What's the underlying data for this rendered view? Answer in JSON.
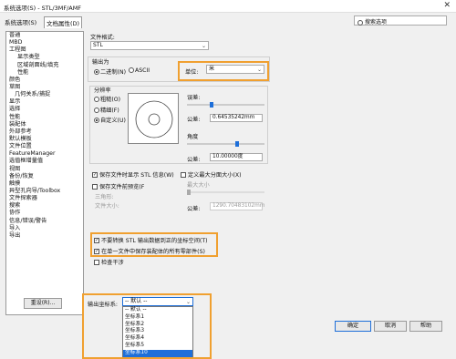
{
  "title": "系统选项(S) - STL/3MF/AMF",
  "tabs": [
    "系统选项(S)",
    "文档属性(D)"
  ],
  "search_placeholder": "搜索选项",
  "tree": [
    {
      "label": "普通",
      "level": 0
    },
    {
      "label": "MBD",
      "level": 0
    },
    {
      "label": "工程图",
      "level": 0
    },
    {
      "label": "显示类型",
      "level": 2
    },
    {
      "label": "区域剖面线/填充",
      "level": 2
    },
    {
      "label": "性能",
      "level": 2
    },
    {
      "label": "颜色",
      "level": 0
    },
    {
      "label": "草图",
      "level": 0
    },
    {
      "label": "几何关系/捕捉",
      "level": 1
    },
    {
      "label": "显示",
      "level": 0
    },
    {
      "label": "选择",
      "level": 0
    },
    {
      "label": "性能",
      "level": 0
    },
    {
      "label": "装配体",
      "level": 0
    },
    {
      "label": "外部参考",
      "level": 0
    },
    {
      "label": "默认模板",
      "level": 0
    },
    {
      "label": "文件位置",
      "level": 0
    },
    {
      "label": "FeatureManager",
      "level": 0
    },
    {
      "label": "选值框增量值",
      "level": 0
    },
    {
      "label": "视图",
      "level": 0
    },
    {
      "label": "备份/恢复",
      "level": 0
    },
    {
      "label": "触摸",
      "level": 0
    },
    {
      "label": "异型孔向导/Toolbox",
      "level": 0
    },
    {
      "label": "文件探索器",
      "level": 0
    },
    {
      "label": "搜索",
      "level": 0
    },
    {
      "label": "协作",
      "level": 0
    },
    {
      "label": "信息/错误/警告",
      "level": 0
    },
    {
      "label": "导入",
      "level": 0
    },
    {
      "label": "导出",
      "level": 0
    }
  ],
  "reset_label": "重设(R)...",
  "file_format_label": "文件格式:",
  "file_format_value": "STL",
  "output_as_label": "输出为",
  "binary_label": "二进制(N)",
  "ascii_label": "ASCII",
  "unit_label": "单位:",
  "unit_value": "米",
  "resolution_label": "分辨率",
  "coarse_label": "粗糙(O)",
  "fine_label": "精细(F)",
  "custom_label": "自定义(U)",
  "deviation_label": "误差:",
  "tolerance_label": "公差:",
  "tolerance_value": "0.64535242mm",
  "angle_label": "角度",
  "angle_tol_label": "公差:",
  "angle_tol_value": "10.00000度",
  "show_info_label": "保存文件时显示 STL 信息(W)",
  "max_length_label": "定义最大分面大小(X)",
  "preview_label": "保存文件前预览(F",
  "max_size_label": "最大大小",
  "triangle_label": "三角形:",
  "file_size_label": "文件大小:",
  "max_tol_label": "公差:",
  "max_tol_value": "1290.70483102mm",
  "no_translate_label": "不要转换 STL 输出数据到正的坐标空间(T)",
  "save_all_label": "在单一文件中保存装配体的所有零部件(S)",
  "check_interfere_label": "检查干涉",
  "output_coord_label": "输出坐标系:",
  "output_coord_value": "-- 默认 --",
  "coord_options": [
    "-- 默认 --",
    "坐标系1",
    "坐标系2",
    "坐标系3",
    "坐标系4",
    "坐标系5",
    "坐标系10"
  ],
  "ok_label": "确定",
  "cancel_label": "取消",
  "help_label": "帮助",
  "accent": "#f0a030",
  "selection": "#1e6fd9"
}
